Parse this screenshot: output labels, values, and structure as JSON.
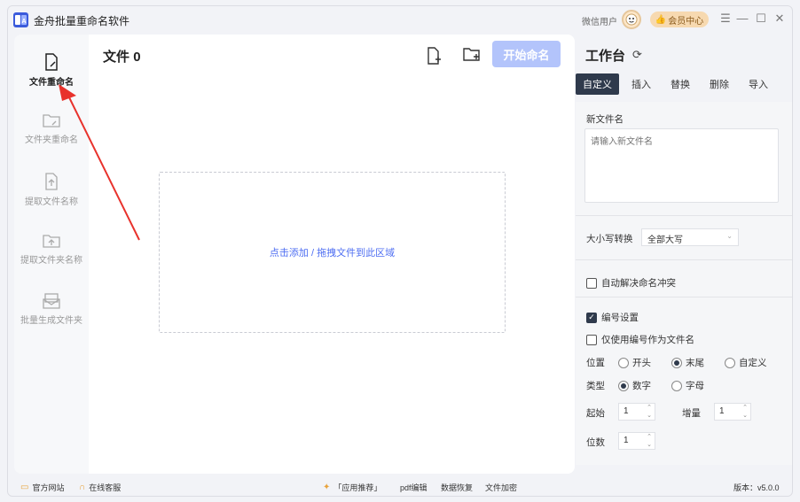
{
  "app": {
    "logo_text": "a",
    "title": "金舟批量重命名软件",
    "user_label": "微信用户",
    "vip_label": "会员中心"
  },
  "sidebar": {
    "items": [
      {
        "label": "文件重命名",
        "icon": "file-rename-icon",
        "active": true
      },
      {
        "label": "文件夹重命名",
        "icon": "folder-rename-icon",
        "active": false
      },
      {
        "label": "提取文件名称",
        "icon": "extract-filename-icon",
        "active": false
      },
      {
        "label": "提取文件夹名称",
        "icon": "extract-foldername-icon",
        "active": false
      },
      {
        "label": "批量生成文件夹",
        "icon": "batch-folder-icon",
        "active": false
      }
    ]
  },
  "main": {
    "files_label": "文件",
    "files_count": "0",
    "add_file_icon": "add-file-icon",
    "add_folder_icon": "add-folder-icon",
    "start_button": "开始命名",
    "dropzone_text": "点击添加 / 拖拽文件到此区域"
  },
  "workbench": {
    "title": "工作台",
    "tabs": [
      {
        "label": "自定义",
        "active": true
      },
      {
        "label": "插入",
        "active": false
      },
      {
        "label": "替换",
        "active": false
      },
      {
        "label": "删除",
        "active": false
      },
      {
        "label": "导入",
        "active": false
      }
    ],
    "new_name_label": "新文件名",
    "new_name_placeholder": "请输入新文件名",
    "case_label": "大小写转换",
    "case_value": "全部大写",
    "auto_resolve_label": "自动解决命名冲突",
    "auto_resolve_checked": false,
    "numbering_label": "编号设置",
    "numbering_checked": true,
    "only_number_label": "仅使用编号作为文件名",
    "only_number_checked": false,
    "position_label": "位置",
    "position_options": [
      "开头",
      "末尾",
      "自定义"
    ],
    "position_selected": "末尾",
    "type_label": "类型",
    "type_options": [
      "数字",
      "字母"
    ],
    "type_selected": "数字",
    "start_label": "起始",
    "start_value": "1",
    "increment_label": "增量",
    "increment_value": "1",
    "digits_label": "位数",
    "digits_value": "1"
  },
  "statusbar": {
    "official_site": "官方网站",
    "online_service": "在线客服",
    "app_recommend": "「应用推荐」",
    "links": [
      "pdf编辑",
      "数据恢复",
      "文件加密"
    ],
    "version": "版本：v5.0.0"
  },
  "colors": {
    "accent": "#4e6ef2",
    "start_button_bg": "#b3c4fb",
    "active_tab_bg": "#2f3a4c",
    "annotation_arrow": "#e8322c"
  }
}
